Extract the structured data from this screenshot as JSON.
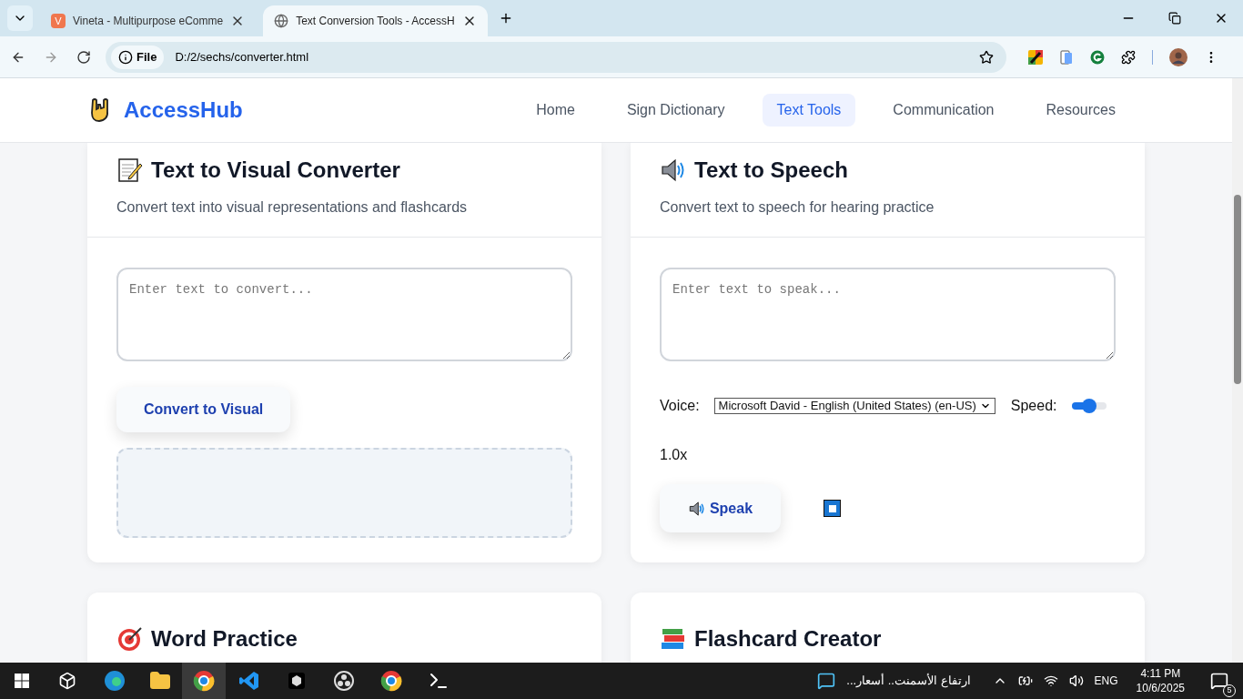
{
  "browser": {
    "tabs": [
      {
        "title": "Vineta - Multipurpose eComme",
        "icon_letter": "V",
        "selected": false
      },
      {
        "title": "Text Conversion Tools - AccessH",
        "selected": true
      }
    ],
    "address": {
      "scheme": "File",
      "url": "D:/2/sechs/converter.html"
    }
  },
  "site": {
    "logo": "AccessHub",
    "nav": [
      {
        "label": "Home",
        "selected": false
      },
      {
        "label": "Sign Dictionary",
        "selected": false
      },
      {
        "label": "Text Tools",
        "selected": true
      },
      {
        "label": "Communication",
        "selected": false
      },
      {
        "label": "Resources",
        "selected": false
      }
    ]
  },
  "cards": [
    {
      "kind": "visual",
      "title": "Text to Visual Converter",
      "subtitle": "Convert text into visual representations and flashcards",
      "placeholder": "Enter text to convert...",
      "button": "Convert to Visual"
    },
    {
      "kind": "speech",
      "title": "Text to Speech",
      "subtitle": "Convert text to speech for hearing practice",
      "placeholder": "Enter text to speak...",
      "voice_label": "Voice:",
      "voice": "Microsoft David - English (United States) (en-US)",
      "speed_label": "Speed:",
      "speed": {
        "level": 0.5
      },
      "speed_reading": "1.0x",
      "button": "Speak"
    },
    {
      "kind": "partial",
      "title": "Word Practice"
    },
    {
      "kind": "partial",
      "title": "Flashcard Creator"
    }
  ],
  "taskbar": {
    "news": "ارتفاع الأسمنت.. أسعار...",
    "language": "ENG",
    "time": "4:11 PM",
    "date": "10/6/2025",
    "notifications": "5"
  }
}
